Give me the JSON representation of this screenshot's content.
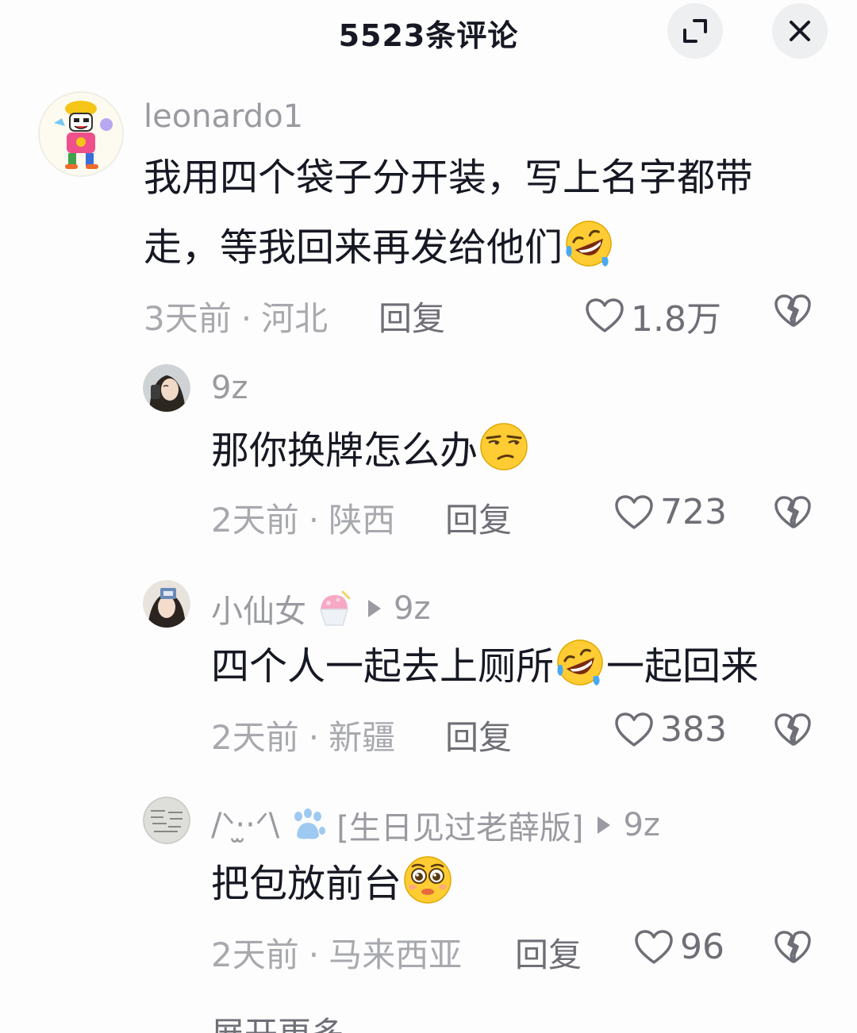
{
  "header": {
    "title": "5523条评论"
  },
  "comments": [
    {
      "username": "leonardo1",
      "text": "我用四个袋子分开装，写上名字都带走，等我回来再发给他们",
      "emoji": "rofl-emoji",
      "time": "3天前",
      "location": "河北",
      "reply_label": "回复",
      "likes": "1.8万"
    },
    {
      "username": "9z",
      "text": "那你换牌怎么办",
      "emoji": "smirk-emoji",
      "time": "2天前",
      "location": "陕西",
      "reply_label": "回复",
      "likes": "723"
    },
    {
      "username": "小仙女",
      "reply_to": "9z",
      "text_before": "四个人一起去上厕所",
      "text_after": "一起回来",
      "emoji": "rofl-emoji",
      "time": "2天前",
      "location": "新疆",
      "reply_label": "回复",
      "likes": "383"
    },
    {
      "username": "/ᐠ. ̫.ᐟ\\ฅ 🐾[生日见过老薛版]",
      "username_main": "/ᐠ·̫·ᐟ\\",
      "username_tag": "[生日见过老薛版]",
      "reply_to": "9z",
      "text": "把包放前台",
      "emoji": "pleading-emoji",
      "time": "2天前",
      "location": "马来西亚",
      "reply_label": "回复",
      "likes": "96"
    }
  ],
  "more_label": "展开更多"
}
